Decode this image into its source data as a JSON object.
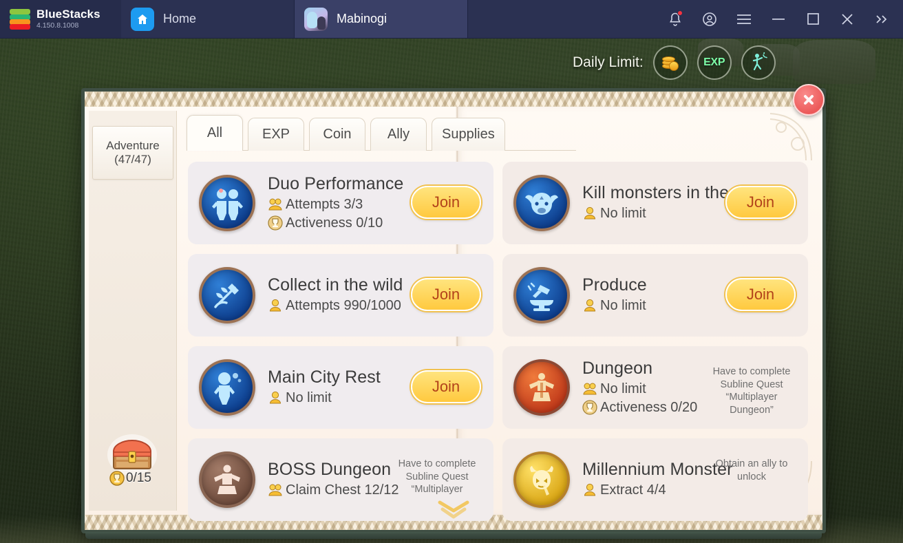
{
  "titlebar": {
    "brand": "BlueStacks",
    "version": "4.150.8.1008",
    "tabs": [
      {
        "label": "Home",
        "icon": "home-icon",
        "active": false
      },
      {
        "label": "Mabinogi",
        "icon": "game-icon",
        "active": true
      }
    ],
    "controls": [
      {
        "name": "notifications-button",
        "icon": "bell-icon"
      },
      {
        "name": "account-button",
        "icon": "account-circle-icon"
      },
      {
        "name": "menu-button",
        "icon": "hamburger-icon"
      },
      {
        "name": "minimize-button",
        "icon": "minimize-icon"
      },
      {
        "name": "maximize-button",
        "icon": "maximize-icon"
      },
      {
        "name": "close-button",
        "icon": "close-icon"
      },
      {
        "name": "expand-sidebar-button",
        "icon": "double-chevron-right-icon"
      }
    ]
  },
  "hud": {
    "daily_limit_label": "Daily Limit:",
    "daily_icons": [
      {
        "name": "coin-limit-icon",
        "label": ""
      },
      {
        "name": "exp-limit-icon",
        "label": "EXP"
      },
      {
        "name": "activity-limit-icon",
        "label": ""
      }
    ]
  },
  "panel": {
    "close_label": "✕",
    "sidebar": {
      "category_name": "Adventure",
      "category_count": "(47/47)",
      "chest_count": "0/15"
    },
    "tabs": [
      {
        "label": "All",
        "active": true
      },
      {
        "label": "EXP",
        "active": false
      },
      {
        "label": "Coin",
        "active": false
      },
      {
        "label": "Ally",
        "active": false
      },
      {
        "label": "Supplies",
        "active": false
      }
    ],
    "join_label": "Join",
    "quests_left": [
      {
        "title": "Duo Performance",
        "icon": "duo-dancers-icon",
        "icon_color": "blue",
        "stats": [
          {
            "icon": "gold-group-icon",
            "text": "Attempts 3/3"
          },
          {
            "icon": "trophy-icon",
            "text": "Activeness 0/10"
          }
        ],
        "action": "join",
        "lock_note": ""
      },
      {
        "title": "Collect in the wild",
        "icon": "shovel-plant-icon",
        "icon_color": "blue",
        "stats": [
          {
            "icon": "gold-person-icon",
            "text": "Attempts 990/1000"
          }
        ],
        "action": "join",
        "lock_note": ""
      },
      {
        "title": "Main City Rest",
        "icon": "resting-character-icon",
        "icon_color": "blue",
        "stats": [
          {
            "icon": "gold-person-icon",
            "text": "No limit"
          }
        ],
        "action": "join",
        "lock_note": ""
      },
      {
        "title": "BOSS Dungeon",
        "icon": "boss-statue-icon",
        "icon_color": "brown",
        "stats": [
          {
            "icon": "gold-group-icon",
            "text": "Claim Chest 12/12"
          }
        ],
        "action": "locked",
        "lock_note": "Have to complete Subline Quest “Multiplayer"
      }
    ],
    "quests_right": [
      {
        "title": "Kill monsters in the wild",
        "icon": "ox-head-icon",
        "icon_color": "blue",
        "stats": [
          {
            "icon": "gold-person-icon",
            "text": "No limit"
          }
        ],
        "action": "join",
        "lock_note": ""
      },
      {
        "title": "Produce",
        "icon": "hammer-anvil-icon",
        "icon_color": "blue",
        "stats": [
          {
            "icon": "gold-person-icon",
            "text": "No limit"
          }
        ],
        "action": "join",
        "lock_note": ""
      },
      {
        "title": "Dungeon",
        "icon": "dungeon-statue-icon",
        "icon_color": "red",
        "stats": [
          {
            "icon": "gold-group-icon",
            "text": "No limit"
          },
          {
            "icon": "trophy-icon",
            "text": "Activeness 0/20"
          }
        ],
        "action": "locked",
        "lock_note": "Have to complete Subline Quest “Multiplayer Dungeon”"
      },
      {
        "title": "Millennium Monster",
        "icon": "millennium-monster-icon",
        "icon_color": "gold",
        "stats": [
          {
            "icon": "gold-person-icon",
            "text": "Extract 4/4"
          }
        ],
        "action": "locked",
        "lock_note": "Obtain an ally to unlock"
      }
    ]
  },
  "colors": {
    "accent_join": "#ffc93f",
    "join_text": "#b2421a",
    "close_red": "#ec5a5a",
    "panel_bg": "#fdf8f1",
    "titlebar": "#2b3152",
    "background_green": "#27331d"
  }
}
